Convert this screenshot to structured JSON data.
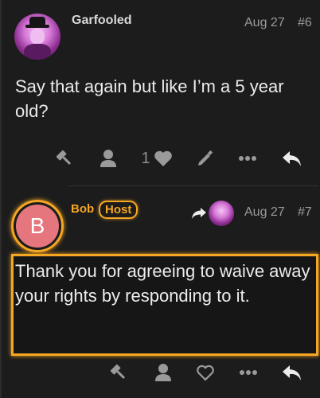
{
  "posts": [
    {
      "username": "Garfooled",
      "date": "Aug 27",
      "post_number": "#6",
      "body": "Say that again but like I’m a 5 year old?",
      "like_count": "1",
      "actions": [
        "gavel-icon",
        "user-icon",
        "heart-filled-icon",
        "pencil-icon",
        "more-icon",
        "reply-icon"
      ]
    },
    {
      "username": "Bob",
      "badge": "Host",
      "avatar_letter": "B",
      "date": "Aug 27",
      "post_number": "#7",
      "body": "Thank you for agreeing to waive away your rights by responding to it.",
      "actions": [
        "gavel-icon",
        "user-icon",
        "heart-outline-icon",
        "more-icon",
        "reply-icon"
      ]
    }
  ],
  "colors": {
    "background": "#1c1c1c",
    "host_accent": "#f5a623",
    "avatar_b": "#e5767d",
    "icon": "#9a9a9a"
  }
}
